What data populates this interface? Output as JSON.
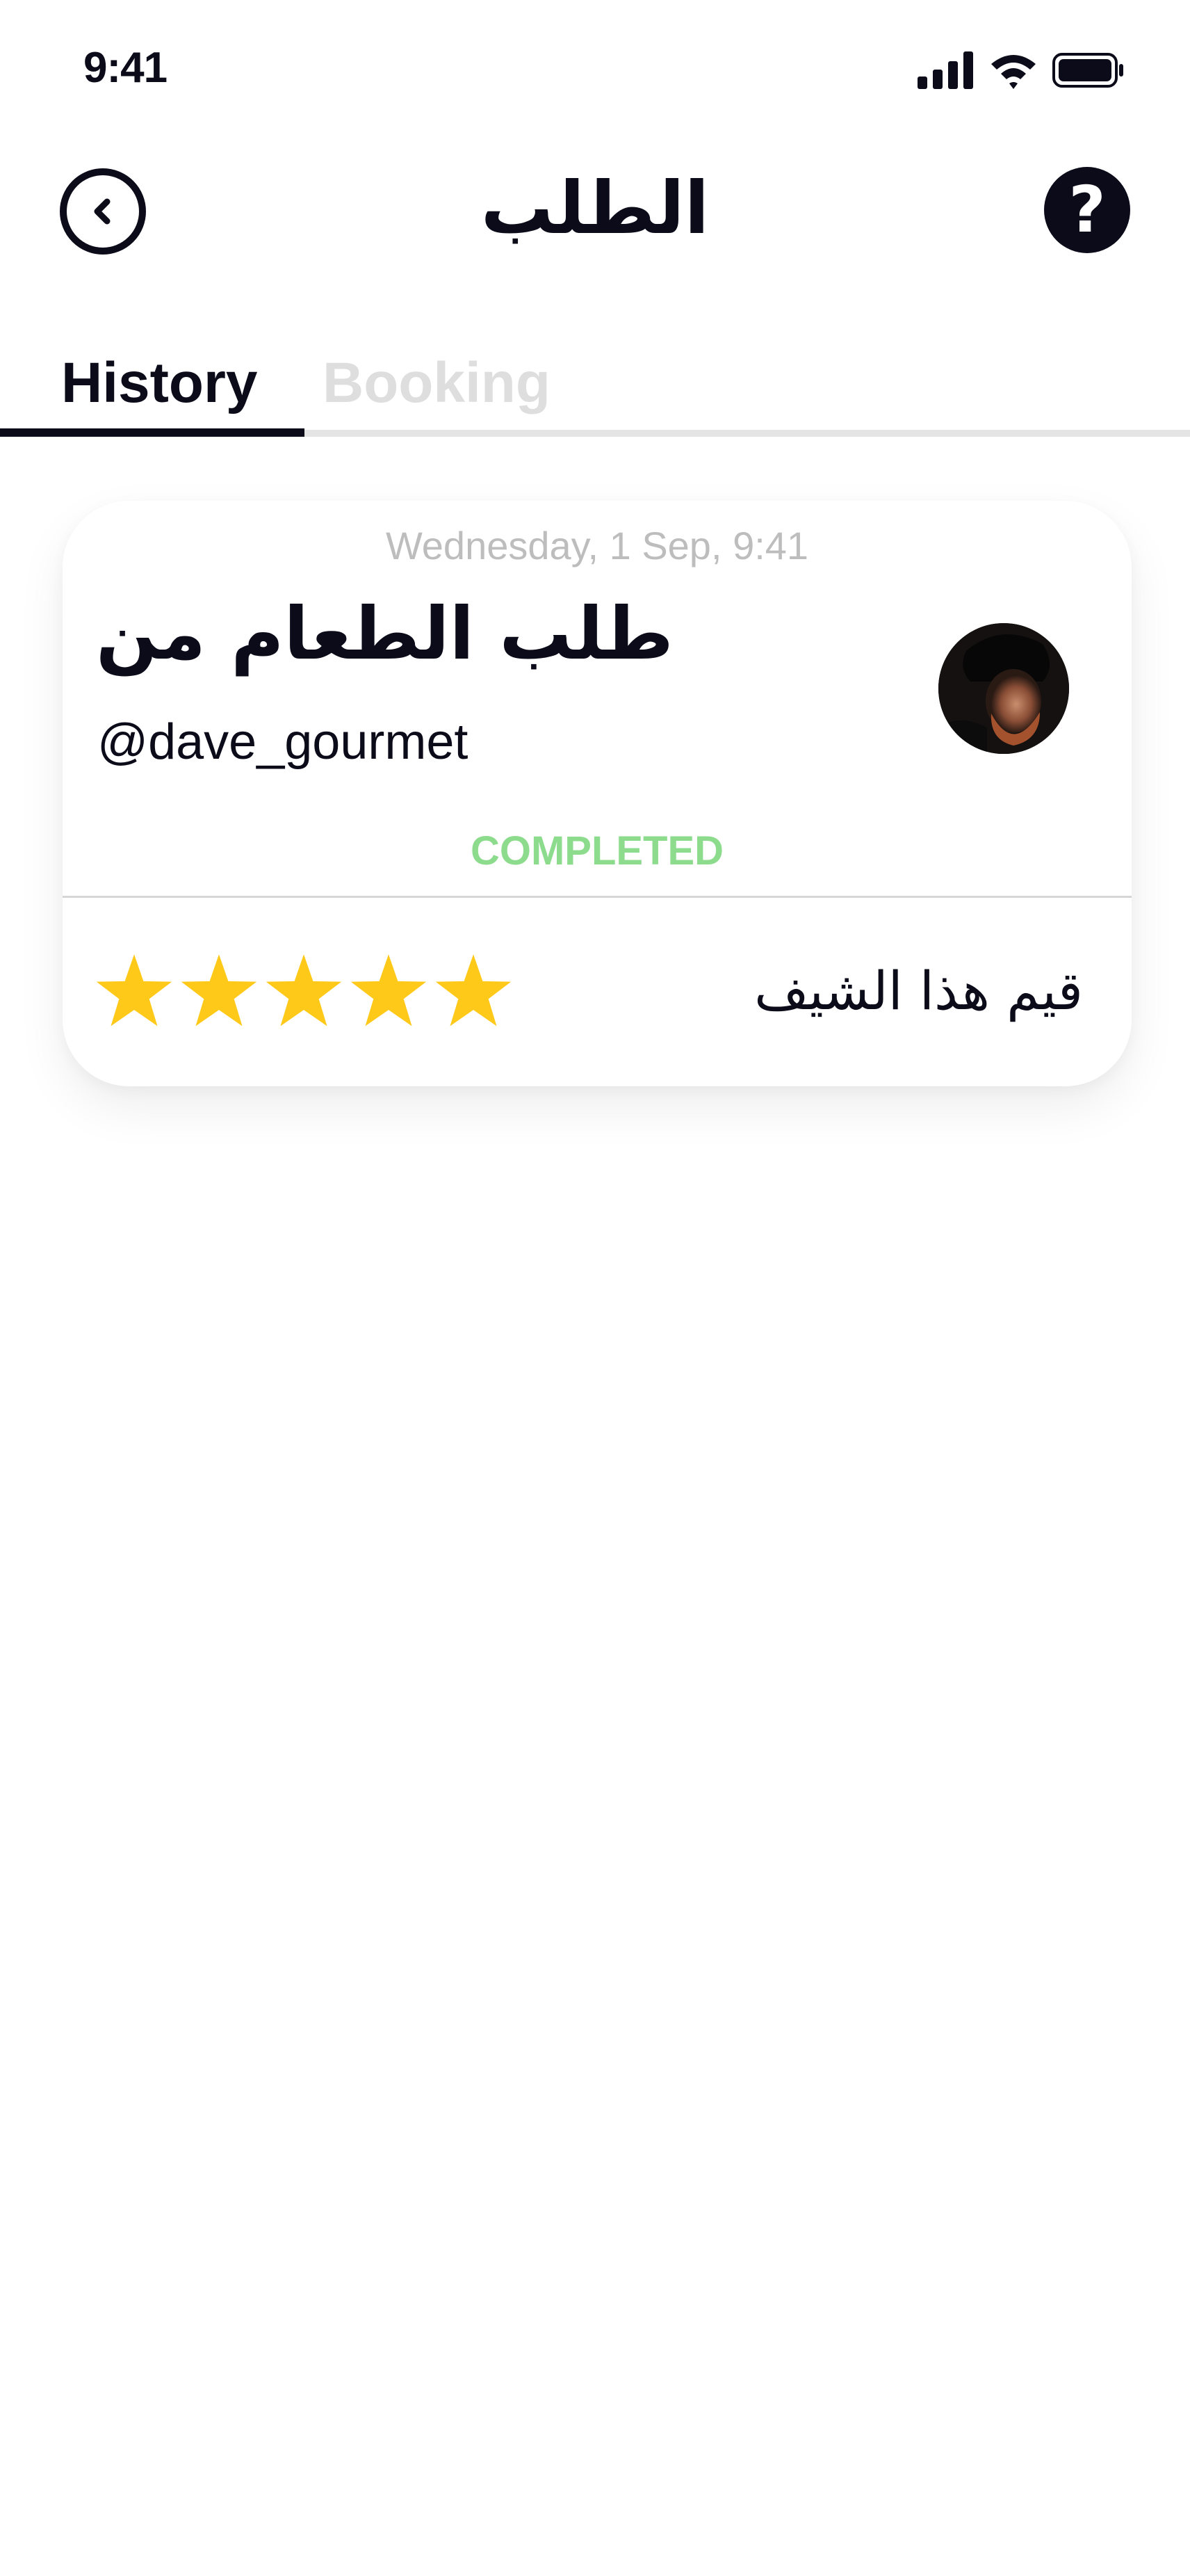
{
  "status_bar": {
    "time": "9:41",
    "icons": [
      "signal-icon",
      "wifi-icon",
      "battery-icon"
    ]
  },
  "header": {
    "title": "الطلب",
    "back_icon": "chevron-left-icon",
    "help_icon": "question-mark-icon",
    "help_glyph": "?"
  },
  "tabs": [
    {
      "label": "History",
      "active": true
    },
    {
      "label": "Booking",
      "active": false
    }
  ],
  "order_card": {
    "date": "Wednesday, 1 Sep, 9:41",
    "title": "طلب الطعام من",
    "chef_handle": "@dave_gourmet",
    "status": "COMPLETED",
    "rating": 5,
    "rating_max": 5,
    "rate_label": "قيم هذا الشيف"
  },
  "colors": {
    "text_primary": "#0b0b1a",
    "tab_inactive": "#dedede",
    "status_completed": "#8ddc8e",
    "star": "#ffc91a",
    "date_text": "#bdbdbd"
  }
}
